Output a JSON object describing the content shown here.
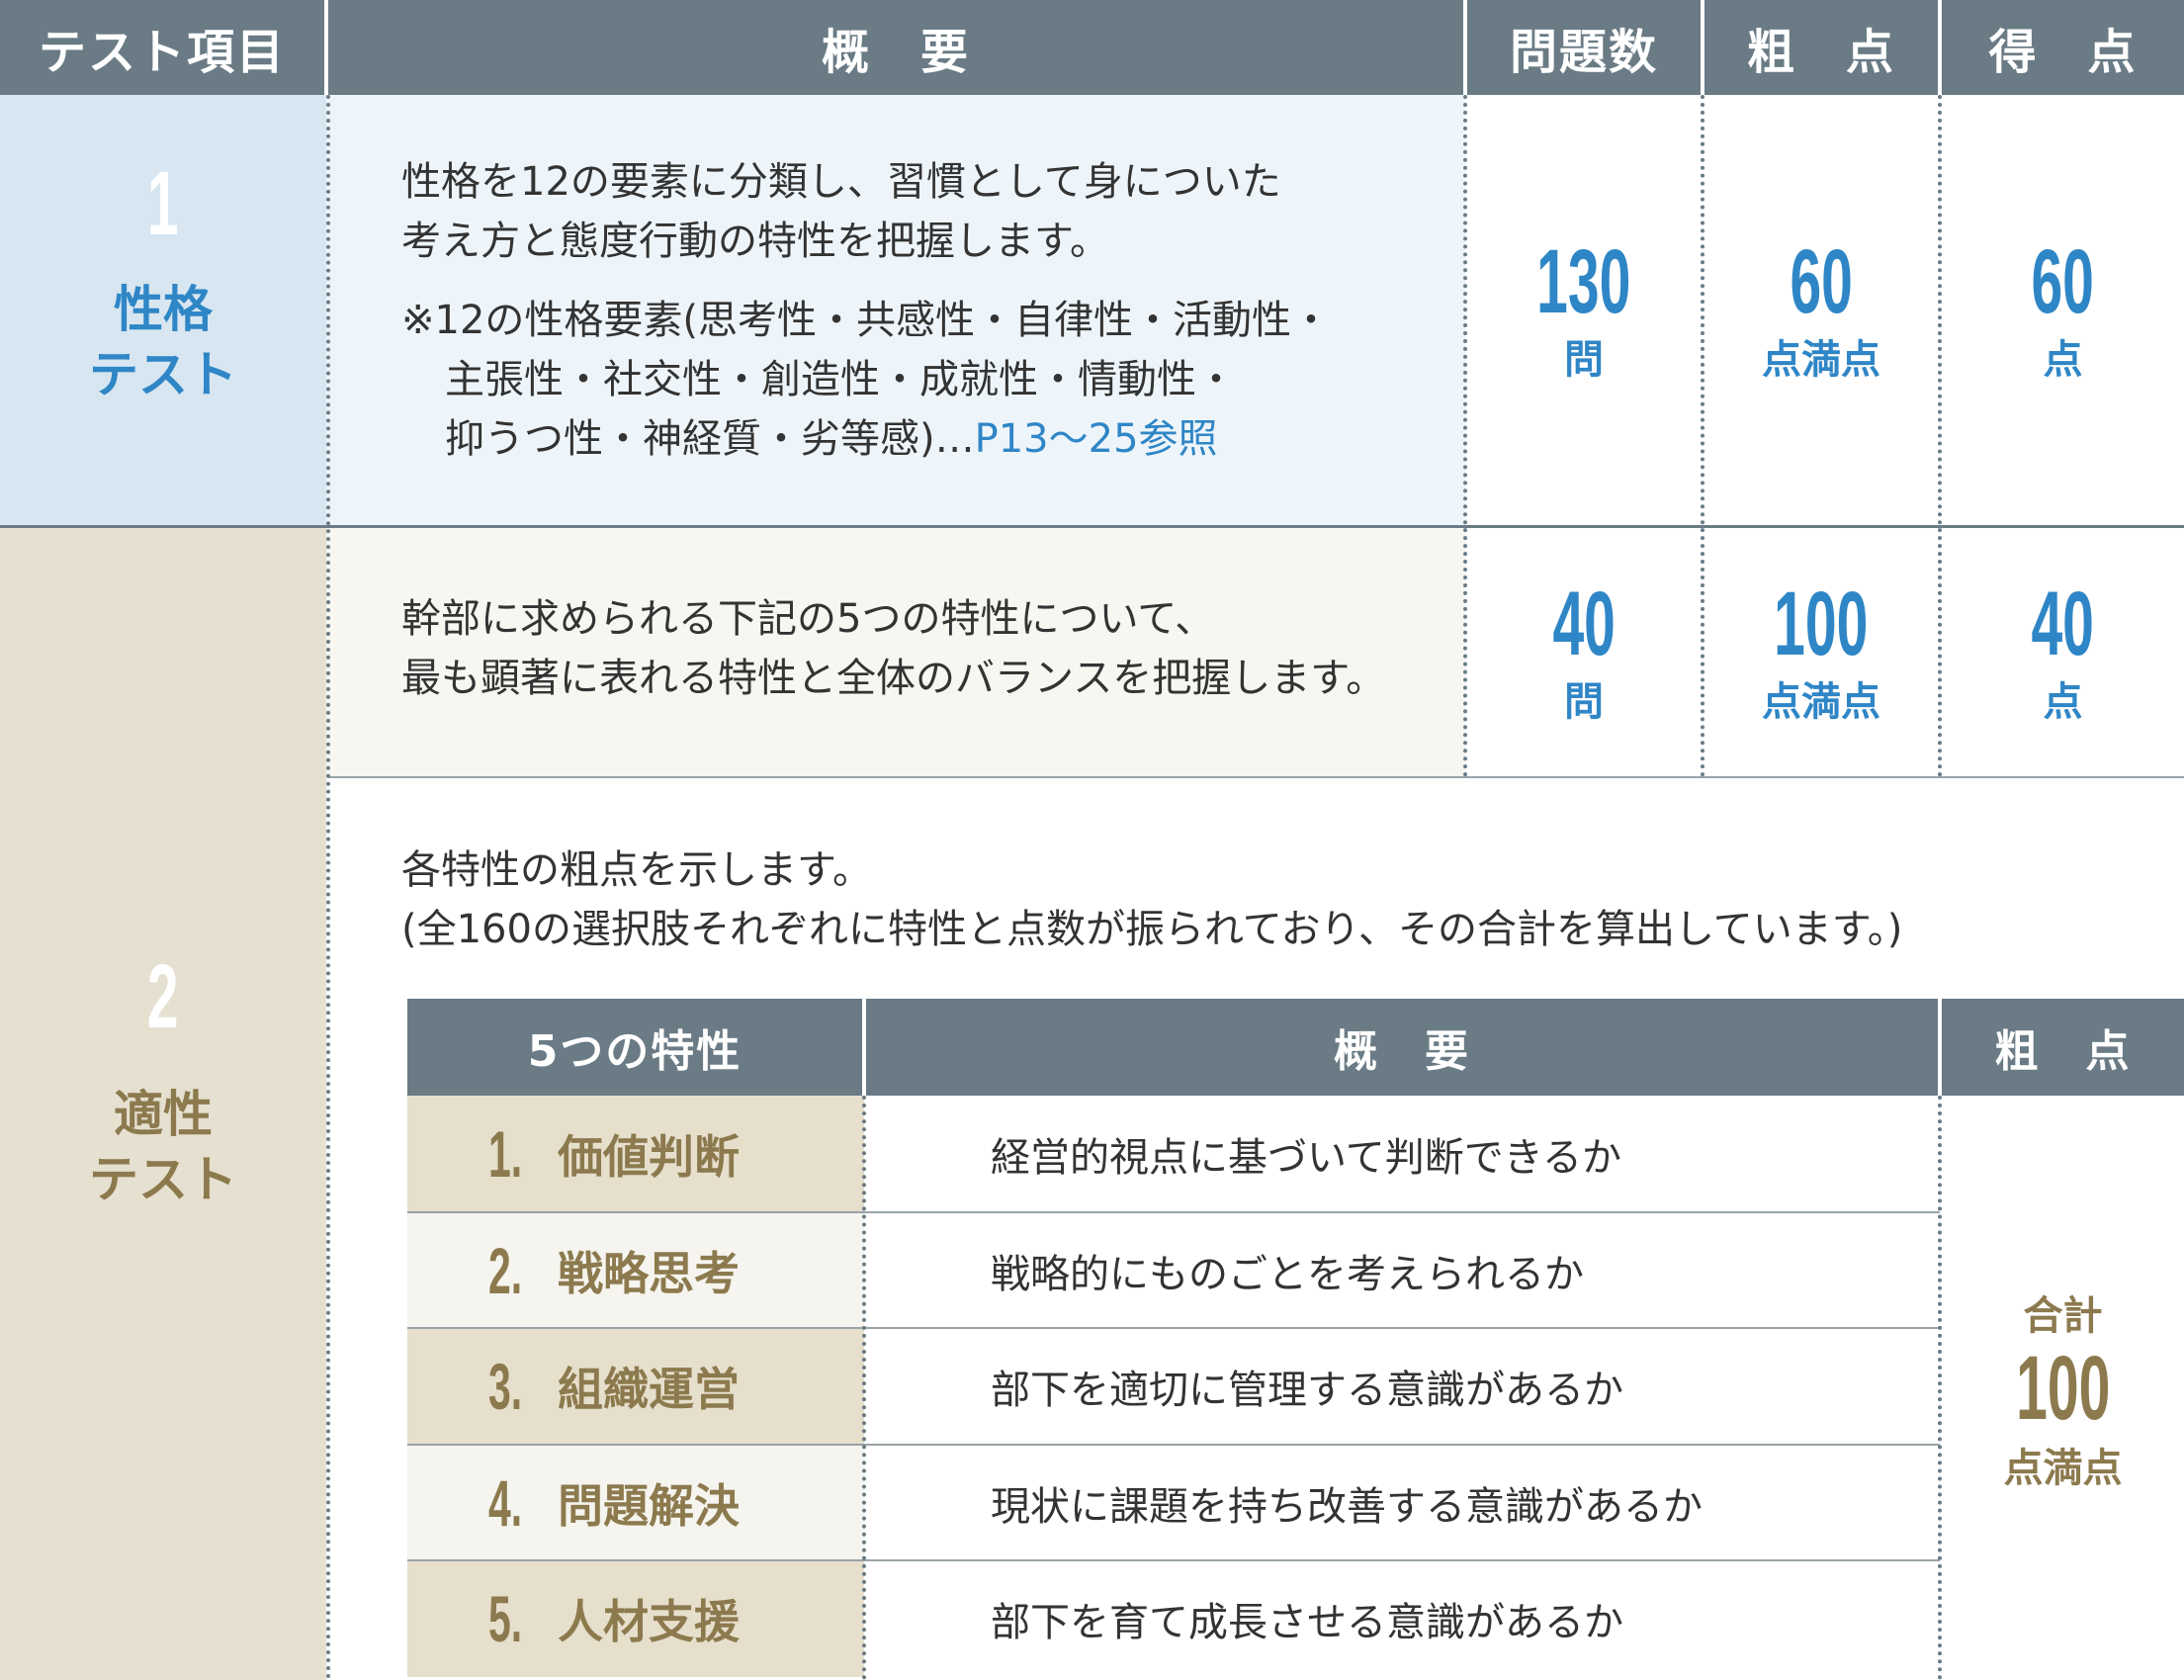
{
  "header": {
    "col1": "テスト項目",
    "col2": "概　要",
    "col3": "問題数",
    "col4": "粗　点",
    "col5": "得　点"
  },
  "colors": {
    "header_bg": "#6a7b85",
    "row1_label_bg": "#d7e6f1",
    "row1_body_bg": "#eef5fa",
    "row2_label_bg": "#e6e0d1",
    "row2_body_bg": "#f7f6f1",
    "trait_bg_dark": "#e6dfcc",
    "trait_bg_light": "#f5f4ee",
    "accent_blue": "#2f86c6",
    "accent_gold": "#8c7a4e"
  },
  "row1": {
    "number": "1",
    "title_line1": "性格",
    "title_line2": "テスト",
    "desc_line1": "性格を12の要素に分類し、習慣として身についた",
    "desc_line2": "考え方と態度行動の特性を把握します。",
    "note_line1": "※12の性格要素(思考性・共感性・自律性・活動性・",
    "note_line2": "主張性・社交性・創造性・成就性・情動性・",
    "note_line3": "抑うつ性・神経質・劣等感)…",
    "note_ref": "P13〜25参照",
    "questions_value": "130",
    "questions_unit": "問",
    "raw_value": "60",
    "raw_unit": "点満点",
    "score_value": "60",
    "score_unit": "点"
  },
  "row2": {
    "number": "2",
    "title_line1": "適性",
    "title_line2": "テスト",
    "desc_line1": "幹部に求められる下記の5つの特性について、",
    "desc_line2": "最も顕著に表れる特性と全体のバランスを把握します。",
    "questions_value": "40",
    "questions_unit": "問",
    "raw_value": "100",
    "raw_unit": "点満点",
    "score_value": "40",
    "score_unit": "点",
    "sub_line1": "各特性の粗点を示します。",
    "sub_line2": "(全160の選択肢それぞれに特性と点数が振られており、その合計を算出しています。)"
  },
  "traits": {
    "header_col1": "5つの特性",
    "header_col2": "概　要",
    "header_col3": "粗　点",
    "total_label": "合計",
    "total_value": "100",
    "total_unit": "点満点",
    "items": [
      {
        "num": "1.",
        "name": "価値判断",
        "desc": "経営的視点に基づいて判断できるか"
      },
      {
        "num": "2.",
        "name": "戦略思考",
        "desc": "戦略的にものごとを考えられるか"
      },
      {
        "num": "3.",
        "name": "組織運営",
        "desc": "部下を適切に管理する意識があるか"
      },
      {
        "num": "4.",
        "name": "問題解決",
        "desc": "現状に課題を持ち改善する意識があるか"
      },
      {
        "num": "5.",
        "name": "人材支援",
        "desc": "部下を育て成長させる意識があるか"
      }
    ]
  }
}
